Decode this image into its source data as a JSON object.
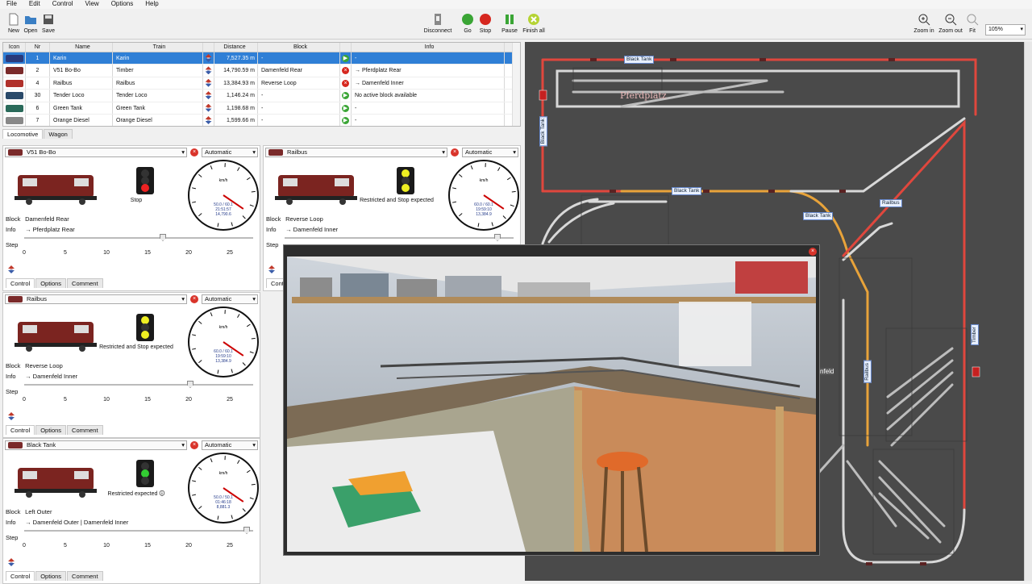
{
  "menu": [
    "File",
    "Edit",
    "Control",
    "View",
    "Options",
    "Help"
  ],
  "toolbar": {
    "new": "New",
    "open": "Open",
    "save": "Save",
    "disconnect": "Disconnect",
    "go": "Go",
    "stop": "Stop",
    "pause": "Pause",
    "finish_all": "Finish all",
    "zoom_in": "Zoom in",
    "zoom_out": "Zoom out",
    "fit": "Fit",
    "zoom_value": "105%"
  },
  "table": {
    "headers": [
      "Icon",
      "Nr",
      "Name",
      "Train",
      "",
      "Distance",
      "Block",
      "",
      "Info"
    ],
    "rows": [
      {
        "nr": "1",
        "name": "Karin",
        "train": "Karin",
        "distance": "7,527.35 m",
        "block": "-",
        "status": "go",
        "info": "-"
      },
      {
        "nr": "2",
        "name": "V51 Bo-Bo",
        "train": "Timber",
        "distance": "14,790.59 m",
        "block": "Damenfeld Rear",
        "status": "stop",
        "info": "→ Pferdplatz Rear"
      },
      {
        "nr": "4",
        "name": "Railbus",
        "train": "Railbus",
        "distance": "13,384.93 m",
        "block": "Reverse Loop",
        "status": "stop",
        "info": "→ Damenfeld Inner"
      },
      {
        "nr": "30",
        "name": "Tender Loco",
        "train": "Tender Loco",
        "distance": "1,146.24 m",
        "block": "-",
        "status": "go",
        "info": "No active block available"
      },
      {
        "nr": "6",
        "name": "Green Tank",
        "train": "Green Tank",
        "distance": "1,198.68 m",
        "block": "-",
        "status": "go",
        "info": "-"
      },
      {
        "nr": "7",
        "name": "Orange Diesel",
        "train": "Orange Diesel",
        "distance": "1,599.66 m",
        "block": "-",
        "status": "go",
        "info": "-"
      }
    ]
  },
  "tabs": {
    "locomotive": "Locomotive",
    "wagon": "Wagon"
  },
  "panel_tabs": {
    "control": "Control",
    "options": "Options",
    "comment": "Comment"
  },
  "labels": {
    "block": "Block",
    "info": "Info",
    "step": "Step",
    "kmh": "km/h",
    "automatic": "Automatic"
  },
  "step_ticks": [
    "0",
    "5",
    "10",
    "15",
    "20",
    "25"
  ],
  "panels": [
    {
      "name": "V51 Bo-Bo",
      "block": "Damenfeld Rear",
      "info": "→ Pferdplatz Rear",
      "signal_text": "Stop",
      "signal": "red",
      "speed": "50.0 / 60.1",
      "time": "21:51:57",
      "dist": "14,790.6",
      "step": 0.6
    },
    {
      "name": "Railbus",
      "block": "Reverse Loop",
      "info": "→ Damenfeld Inner",
      "signal_text": "Restricted and Stop expected",
      "signal": "yellow",
      "speed": "60.0 / 60.1",
      "time": "19:59:10",
      "dist": "13,384.9",
      "step": 0.93
    },
    {
      "name": "Railbus",
      "block": "Reverse Loop",
      "info": "→ Damenfeld Inner",
      "signal_text": "Restricted and Stop expected",
      "signal": "yellow",
      "speed": "60.0 / 60.1",
      "time": "19:59:10",
      "dist": "13,384.9",
      "step": 0.72
    },
    {
      "name": "Black Tank",
      "block": "Left Outer",
      "info": "→ Damenfeld Outer | Damenfeld Inner",
      "signal_text": "Restricted expected 🛈",
      "signal": "green",
      "speed": "50.0 / 50.1",
      "time": "01:46:18",
      "dist": "8,881.3",
      "step": 0.97
    }
  ],
  "layout": {
    "labels": [
      "Black Tank",
      "Black Tank",
      "Black Tank",
      "Black Tank",
      "Railbus",
      "Railbus",
      "Timber"
    ],
    "station": "Pferdplatz",
    "partial_text": "nfeld"
  },
  "colors": {
    "selection": "#2f7fd6",
    "occupied": "#e0473d",
    "route": "#e8a33a",
    "track": "#d8d8d8",
    "background": "#4a4a4a"
  }
}
